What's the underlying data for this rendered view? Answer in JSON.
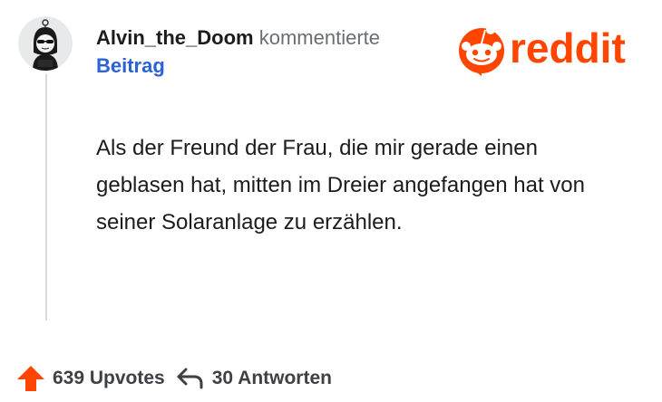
{
  "comment": {
    "username": "Alvin_the_Doom",
    "action": "kommentierte",
    "target": "Beitrag",
    "text": "Als der Freund der Frau, die mir gerade einen geblasen hat, mitten im Dreier angefangen hat von seiner Solaranlage zu erzählen."
  },
  "brand": {
    "name": "reddit",
    "color": "#ff4500"
  },
  "footer": {
    "upvotes_label": "639 Upvotes",
    "replies_label": "30 Antworten"
  },
  "colors": {
    "upvote": "#ff4500",
    "link": "#2c62d6",
    "muted": "#6a6e72"
  }
}
